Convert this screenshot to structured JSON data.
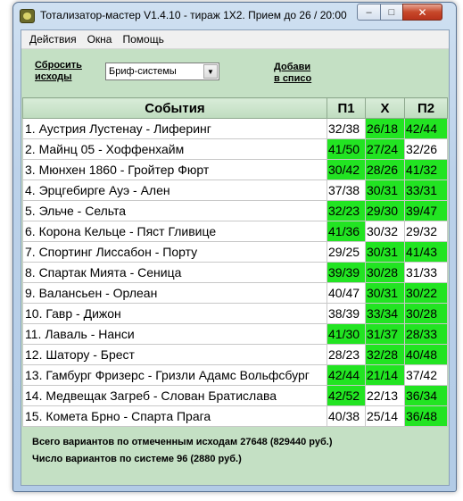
{
  "window": {
    "title": "Тотализатор-мастер V1.4.10 - тираж 1X2. Прием до 26 / 20:00",
    "minimize": "–",
    "maximize": "□",
    "close": "✕"
  },
  "menu": [
    "Действия",
    "Окна",
    "Помощь"
  ],
  "toolbar": {
    "reset_line1": "Сбросить",
    "reset_line2": "исходы",
    "combo_value": "Бриф-системы",
    "add_line1": "Добави",
    "add_line2": "в списо"
  },
  "table": {
    "headers": [
      "События",
      "П1",
      "Х",
      "П2"
    ],
    "rows": [
      {
        "event": "1. Аустрия Лустенау - Лиферинг",
        "p1": "32/38",
        "x": "26/18",
        "p2": "42/44",
        "hl": [
          false,
          true,
          true
        ]
      },
      {
        "event": "2. Майнц 05 - Хоффенхайм",
        "p1": "41/50",
        "x": "27/24",
        "p2": "32/26",
        "hl": [
          true,
          true,
          false
        ]
      },
      {
        "event": "3. Мюнхен 1860 - Гройтер Фюрт",
        "p1": "30/42",
        "x": "28/26",
        "p2": "41/32",
        "hl": [
          true,
          true,
          true
        ]
      },
      {
        "event": "4. Эрцгебирге Ауэ - Ален",
        "p1": "37/38",
        "x": "30/31",
        "p2": "33/31",
        "hl": [
          false,
          true,
          true
        ]
      },
      {
        "event": "5. Эльче - Сельта",
        "p1": "32/23",
        "x": "29/30",
        "p2": "39/47",
        "hl": [
          true,
          true,
          true
        ]
      },
      {
        "event": "6. Корона Кельце - Пяст Гливице",
        "p1": "41/36",
        "x": "30/32",
        "p2": "29/32",
        "hl": [
          true,
          false,
          false
        ]
      },
      {
        "event": "7. Спортинг Лиссабон - Порту",
        "p1": "29/25",
        "x": "30/31",
        "p2": "41/43",
        "hl": [
          false,
          true,
          true
        ]
      },
      {
        "event": "8. Спартак Мията - Сеница",
        "p1": "39/39",
        "x": "30/28",
        "p2": "31/33",
        "hl": [
          true,
          true,
          false
        ]
      },
      {
        "event": "9. Валансьен - Орлеан",
        "p1": "40/47",
        "x": "30/31",
        "p2": "30/22",
        "hl": [
          false,
          true,
          true
        ]
      },
      {
        "event": "10. Гавр - Дижон",
        "p1": "38/39",
        "x": "33/34",
        "p2": "30/28",
        "hl": [
          false,
          true,
          true
        ]
      },
      {
        "event": "11. Лаваль - Нанси",
        "p1": "41/30",
        "x": "31/37",
        "p2": "28/33",
        "hl": [
          true,
          true,
          true
        ]
      },
      {
        "event": "12. Шатору - Брест",
        "p1": "28/23",
        "x": "32/28",
        "p2": "40/48",
        "hl": [
          false,
          true,
          true
        ]
      },
      {
        "event": "13. Гамбург Фризерс - Гризли Адамс Вольфсбург",
        "p1": "42/44",
        "x": "21/14",
        "p2": "37/42",
        "hl": [
          true,
          true,
          false
        ]
      },
      {
        "event": "14. Медвещак Загреб - Слован Братислава",
        "p1": "42/52",
        "x": "22/13",
        "p2": "36/34",
        "hl": [
          true,
          false,
          true
        ]
      },
      {
        "event": "15. Комета Брно - Спарта Прага",
        "p1": "40/38",
        "x": "25/14",
        "p2": "36/48",
        "hl": [
          false,
          false,
          true
        ]
      }
    ]
  },
  "footer": {
    "line1": "Всего вариантов по отмеченным исходам 27648 (829440 руб.)",
    "line2": "Число вариантов по системе 96 (2880 руб.)"
  },
  "colors": {
    "highlight": "#22e422",
    "client_bg": "#c4e0c4"
  }
}
